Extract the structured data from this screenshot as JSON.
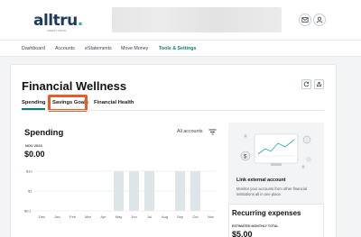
{
  "brand": {
    "name": "alltru",
    "dot": ".",
    "tagline": "CREDIT UNION"
  },
  "nav": {
    "items": [
      {
        "label": "Dashboard"
      },
      {
        "label": "Accounts"
      },
      {
        "label": "eStatements"
      },
      {
        "label": "Move Money"
      },
      {
        "label": "Tools & Settings",
        "active": true
      }
    ]
  },
  "page": {
    "title": "Financial Wellness",
    "tabs": [
      {
        "label": "Spending",
        "active": true
      },
      {
        "label": "Savings Goals",
        "highlighted": true
      },
      {
        "label": "Financial Health"
      }
    ]
  },
  "spending": {
    "heading": "Spending",
    "account_filter": "All accounts",
    "period": "NOV 2023",
    "amount": "$0.00"
  },
  "chart_data": {
    "type": "bar",
    "title": "",
    "xlabel": "",
    "ylabel": "",
    "y_scale": "log",
    "y_ticks": [
      "$10",
      "$1",
      "$0.1"
    ],
    "categories": [
      "Dec",
      "Jan",
      "Feb",
      "Mar",
      "Apr",
      "May",
      "Jun",
      "Jul",
      "Aug",
      "Sep",
      "Oct",
      "Nov"
    ],
    "bar_fill": "#dce6e8",
    "series": [
      {
        "values": [
          null,
          null,
          null,
          null,
          null,
          10,
          10,
          10,
          null,
          10,
          10,
          null
        ]
      }
    ]
  },
  "side": {
    "link_title": "Link external account",
    "link_desc": "Monitor your accounts from other financial institutions all in one place.",
    "recurring_title": "Recurring expenses",
    "recurring_sub": "ESTIMATED MONTHLY TOTAL",
    "recurring_amount": "$5.00"
  },
  "colors": {
    "accent": "#0e7c74",
    "highlight": "#ef5a24",
    "brand": "#1d3a5f"
  },
  "icons": [
    "mail-icon",
    "user-icon",
    "refresh-icon",
    "settings-icon",
    "filter-icon",
    "link-accounts-illustration"
  ]
}
